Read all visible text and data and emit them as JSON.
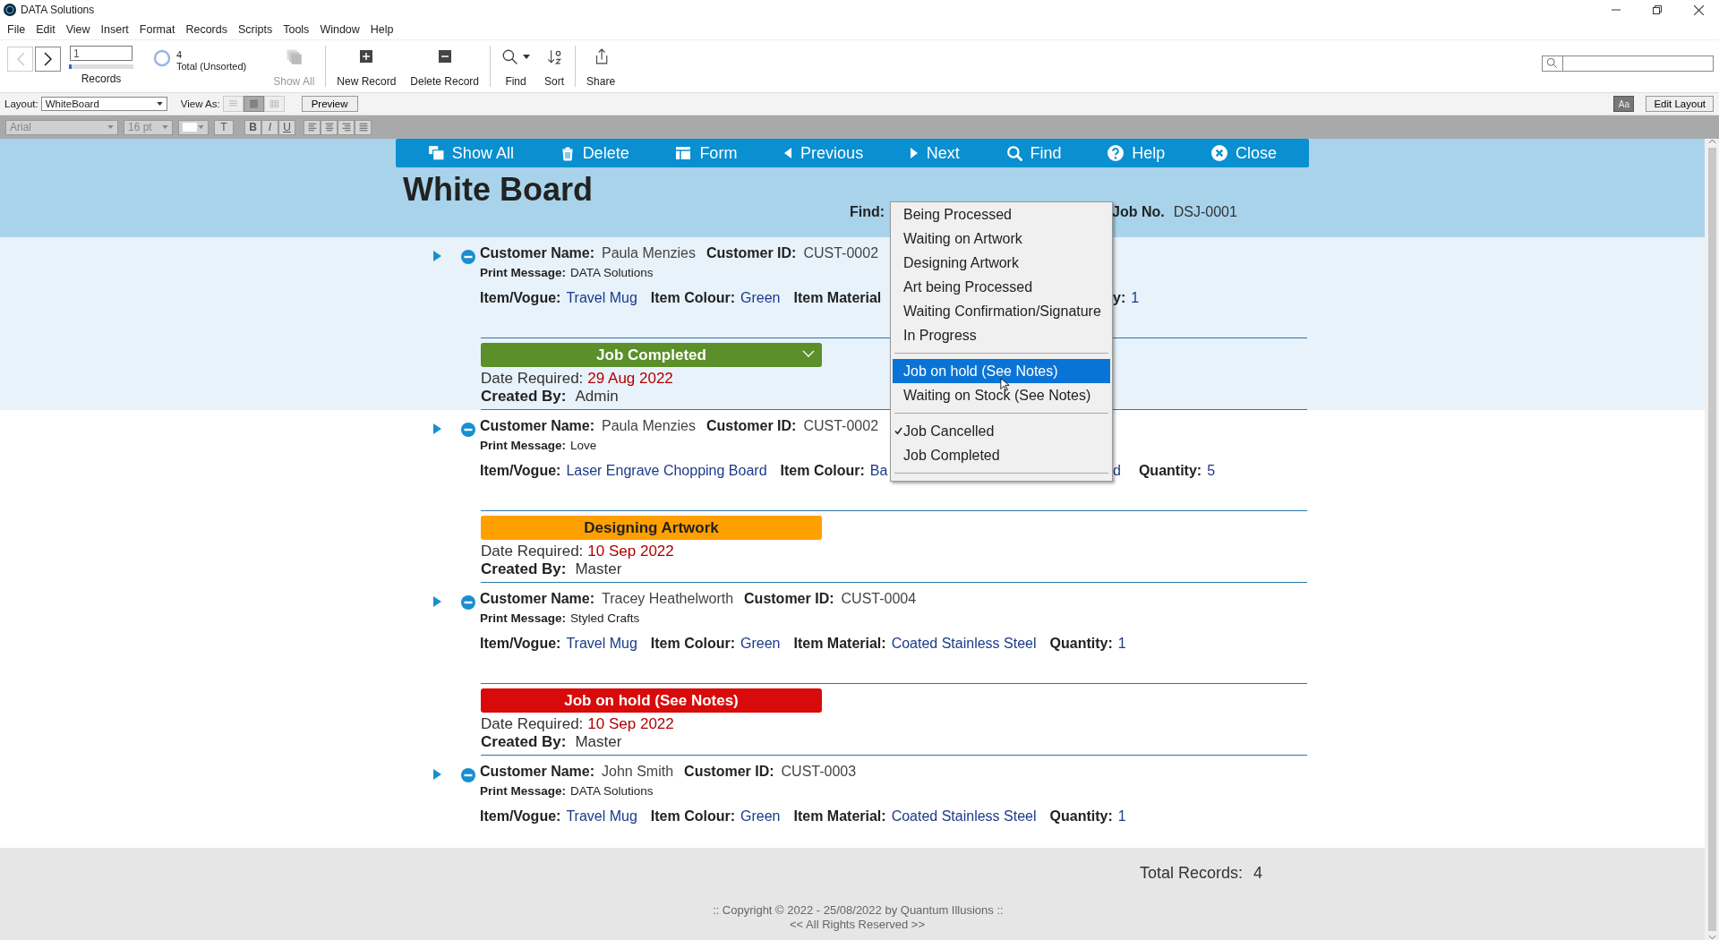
{
  "window": {
    "title": "DATA Solutions"
  },
  "menu": [
    "File",
    "Edit",
    "View",
    "Insert",
    "Format",
    "Records",
    "Scripts",
    "Tools",
    "Window",
    "Help"
  ],
  "toolbar": {
    "nav": [
      {
        "kind": "back",
        "disabled": true
      },
      {
        "kind": "forward",
        "disabled": false
      }
    ],
    "record_number": "1",
    "record_slider": {
      "level": 0.04
    },
    "records_label": "Records",
    "found_count": "4",
    "found_status": "Total (Unsorted)",
    "buttons": [
      {
        "kind": "show_all",
        "label": "Show All",
        "disabled": true
      },
      {
        "kind": "new",
        "label": "New Record",
        "disabled": false
      },
      {
        "kind": "delete",
        "label": "Delete Record",
        "disabled": false
      },
      {
        "kind": "find",
        "label": "Find",
        "disabled": false
      },
      {
        "kind": "sort",
        "label": "Sort",
        "disabled": false
      },
      {
        "kind": "share",
        "label": "Share",
        "disabled": false
      }
    ]
  },
  "layout_bar": {
    "layout_label": "Layout:",
    "layout": "WhiteBoard",
    "view_as_label": "View As:",
    "view_modes": [
      {
        "kind": "form",
        "selected": false
      },
      {
        "kind": "list",
        "selected": true
      },
      {
        "kind": "table",
        "selected": false
      }
    ],
    "preview": "Preview",
    "text_toggle": "Aa",
    "edit_layout": "Edit Layout"
  },
  "format_bar": {
    "font": "Arial",
    "size": "16 pt",
    "text_button": "T",
    "styles": [
      "B",
      "I",
      "U"
    ]
  },
  "nav_buttons": [
    {
      "kind": "show_all",
      "label": "Show All"
    },
    {
      "kind": "delete",
      "label": "Delete"
    },
    {
      "kind": "form",
      "label": "Form"
    },
    {
      "kind": "previous",
      "label": "Previous"
    },
    {
      "kind": "next",
      "label": "Next"
    },
    {
      "kind": "find",
      "label": "Find"
    },
    {
      "kind": "help",
      "label": "Help"
    },
    {
      "kind": "close",
      "label": "Close"
    }
  ],
  "header": {
    "title": "White Board",
    "find_label": "Find:",
    "job_no_label": "Job No.",
    "job_no": "DSJ-0001"
  },
  "records": [
    {
      "selected": true,
      "line1": [
        {
          "label": "Customer Name:",
          "value": "Paula Menzies"
        },
        {
          "label": "Customer ID:",
          "value": "CUST-0002"
        }
      ],
      "print_message": {
        "label": "Print Message:",
        "value": "DATA Solutions"
      },
      "item_fields": [
        {
          "label": "Item/Vogue:",
          "value": "Travel Mug"
        },
        {
          "label": "Item Colour:",
          "value": "Green"
        },
        {
          "label": "Item Material"
        }
      ],
      "item_fields_right": [
        {
          "label": "y:",
          "value": "1"
        }
      ],
      "status": {
        "label": "Job Completed",
        "color": "#5a8f29"
      },
      "date_label": "Date Required:",
      "date": "29 Aug 2022",
      "created_by_label": "Created By:",
      "created_by": "Admin"
    },
    {
      "selected": false,
      "line1": [
        {
          "label": "Customer Name:",
          "value": "Paula Menzies"
        },
        {
          "label": "Customer ID:",
          "value": "CUST-0002"
        }
      ],
      "print_message": {
        "label": "Print Message:",
        "value": "Love"
      },
      "item_fields": [
        {
          "label": "Item/Vogue:",
          "value": "Laser Engrave Chopping Board"
        },
        {
          "label": "Item Colour:",
          "value": "Ba"
        }
      ],
      "item_fields_right": [
        {
          "value": "d"
        },
        {
          "label": "Quantity:",
          "value": "5"
        }
      ],
      "status": {
        "label": "Designing Artwork",
        "color": "#ffa000"
      },
      "date_label": "Date Required:",
      "date": "10 Sep 2022",
      "created_by_label": "Created By:",
      "created_by": "Master"
    },
    {
      "selected": false,
      "line1": [
        {
          "label": "Customer Name:",
          "value": "Tracey Heathelworth"
        },
        {
          "label": "Customer ID:",
          "value": "CUST-0004"
        }
      ],
      "print_message": {
        "label": "Print Message:",
        "value": "Styled Crafts"
      },
      "item_fields": [
        {
          "label": "Item/Vogue:",
          "value": "Travel Mug"
        },
        {
          "label": "Item Colour:",
          "value": "Green"
        },
        {
          "label": "Item Material:",
          "value": "Coated Stainless Steel"
        },
        {
          "label": "Quantity:",
          "value": "1"
        }
      ],
      "status": {
        "label": "Job on hold (See Notes)",
        "color": "#d90a0a"
      },
      "date_label": "Date Required:",
      "date": "10 Sep 2022",
      "created_by_label": "Created By:",
      "created_by": "Master"
    },
    {
      "selected": false,
      "line1": [
        {
          "label": "Customer Name:",
          "value": "John Smith"
        },
        {
          "label": "Customer ID:",
          "value": "CUST-0003"
        }
      ],
      "print_message": {
        "label": "Print Message:",
        "value": "DATA Solutions"
      },
      "item_fields": [
        {
          "label": "Item/Vogue:",
          "value": "Travel Mug"
        },
        {
          "label": "Item Colour:",
          "value": "Green"
        },
        {
          "label": "Item Material:",
          "value": "Coated Stainless Steel"
        },
        {
          "label": "Quantity:",
          "value": "1"
        }
      ]
    }
  ],
  "status_menu": {
    "options": [
      {
        "kind": "option",
        "label": "Being Processed",
        "selected": false,
        "checked": false
      },
      {
        "kind": "option",
        "label": "Waiting on Artwork",
        "selected": false,
        "checked": false
      },
      {
        "kind": "option",
        "label": "Designing Artwork",
        "selected": false,
        "checked": false
      },
      {
        "kind": "option",
        "label": "Art being Processed",
        "selected": false,
        "checked": false
      },
      {
        "kind": "option",
        "label": "Waiting Confirmation/Signature",
        "selected": false,
        "checked": false
      },
      {
        "kind": "option",
        "label": "In Progress",
        "selected": false,
        "checked": false
      },
      {
        "kind": "separator"
      },
      {
        "kind": "option",
        "label": "Job on hold (See Notes)",
        "selected": true,
        "checked": false
      },
      {
        "kind": "option",
        "label": "Waiting on Stock (See Notes)",
        "selected": false,
        "checked": false
      },
      {
        "kind": "separator"
      },
      {
        "kind": "option",
        "label": "Job Cancelled",
        "selected": false,
        "checked": true
      },
      {
        "kind": "option",
        "label": "Job Completed",
        "selected": false,
        "checked": false
      },
      {
        "kind": "separator"
      }
    ]
  },
  "footer": {
    "total_label": "Total Records:",
    "total": "4",
    "copyright": ":: Copyright ©  2022 - 25/08/2022 by Quantum Illusions ::",
    "rights": "<< All Rights Reserved >>"
  }
}
